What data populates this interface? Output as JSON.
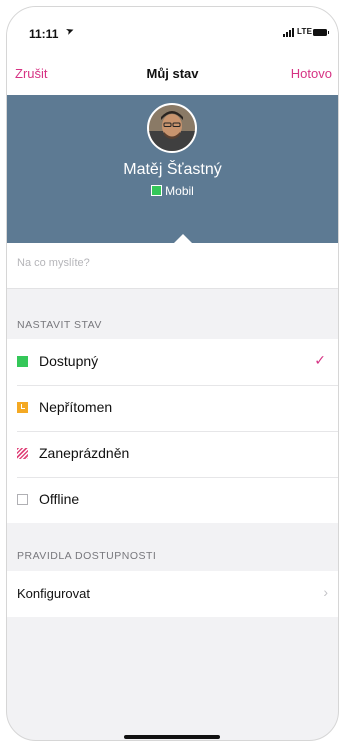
{
  "status_bar": {
    "time": "11:11",
    "network": "LTE"
  },
  "nav": {
    "cancel": "Zrušit",
    "title": "Můj stav",
    "done": "Hotovo"
  },
  "profile": {
    "name": "Matěj Šťastný",
    "device": "Mobil"
  },
  "mood": {
    "placeholder": "Na co myslíte?",
    "value": ""
  },
  "status_section": {
    "header": "NASTAVIT STAV",
    "options": [
      {
        "label": "Dostupný",
        "icon": "available-square-icon",
        "color": "#34c759",
        "selected": true
      },
      {
        "label": "Nepřítomen",
        "icon": "away-clock-icon",
        "color": "#f4a923",
        "selected": false
      },
      {
        "label": "Zaneprázdněn",
        "icon": "busy-striped-icon",
        "color": "#e0457b",
        "selected": false
      },
      {
        "label": "Offline",
        "icon": "offline-square-icon",
        "color": "#b0b0b4",
        "selected": false
      }
    ],
    "selected_mark": "✓"
  },
  "availability_section": {
    "header": "PRAVIDLA DOSTUPNOSTI",
    "configure": "Konfigurovat",
    "chevron": "›"
  },
  "colors": {
    "accent": "#d63384",
    "header_bg": "#5d7a93",
    "page_bg": "#f2f2f4"
  }
}
